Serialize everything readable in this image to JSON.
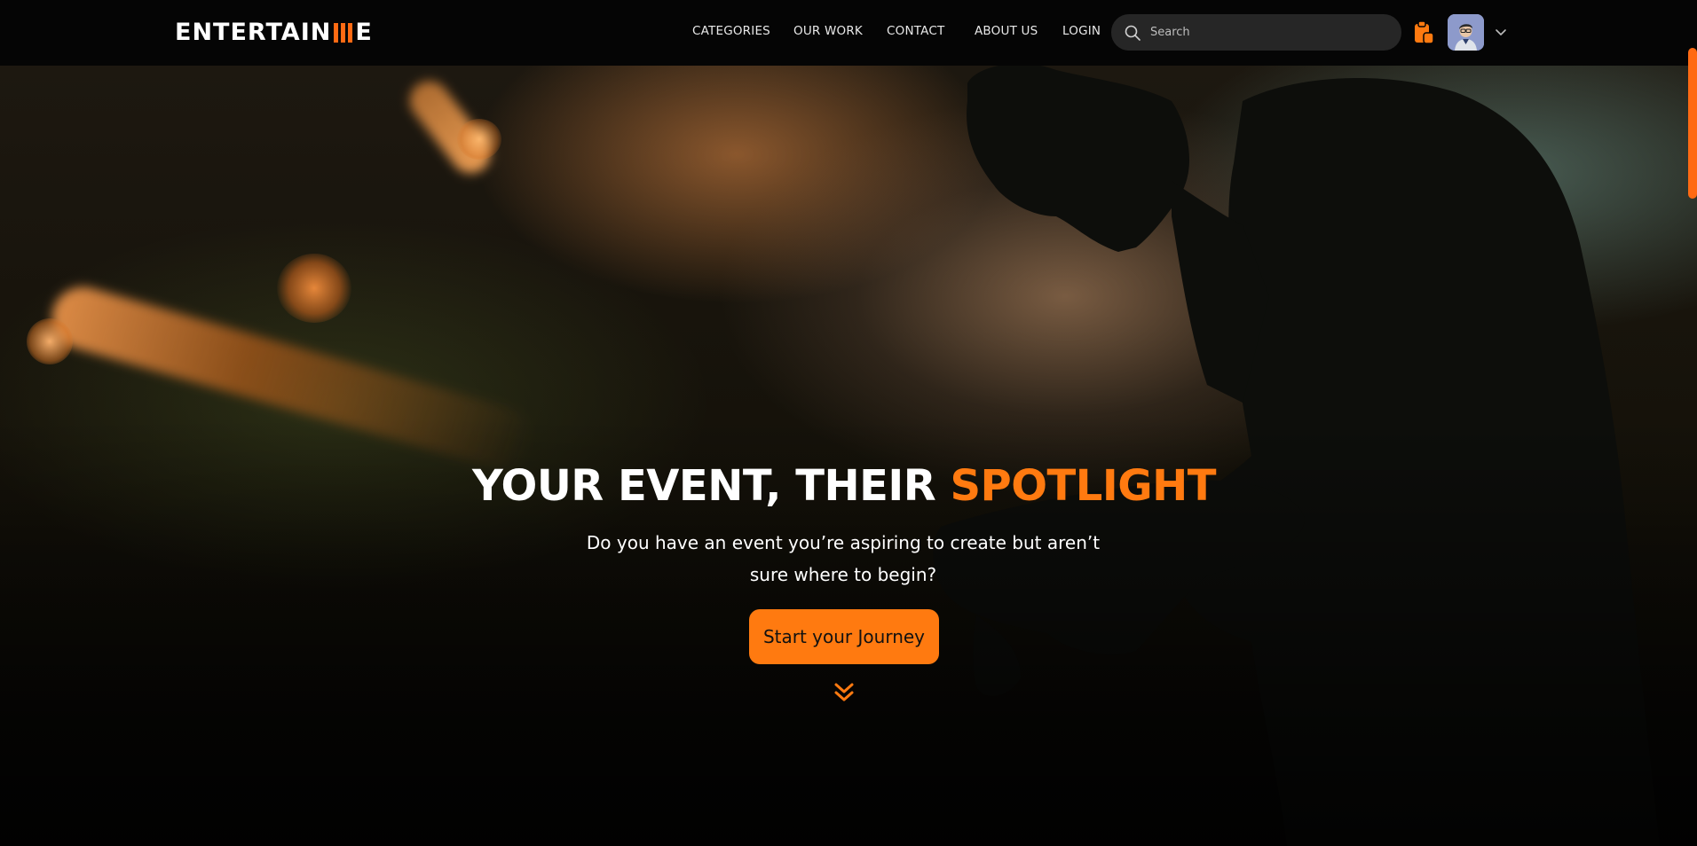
{
  "brand": {
    "logo_text_left": "ENTERTAIN",
    "logo_text_right": "E",
    "accent_color": "#ff7a10"
  },
  "nav": {
    "items": [
      {
        "label": "CATEGORIES"
      },
      {
        "label": "OUR WORK"
      },
      {
        "label": "CONTACT"
      },
      {
        "label": "ABOUT US"
      },
      {
        "label": "LOGIN"
      }
    ]
  },
  "search": {
    "placeholder": "Search",
    "value": ""
  },
  "header_icons": {
    "clipboard": "clipboard-icon",
    "avatar": "user-avatar",
    "menu": "chevron-down-icon"
  },
  "hero": {
    "headline_main": "YOUR EVENT, THEIR ",
    "headline_accent": "SPOTLIGHT",
    "subtext": "Do you have an event you’re aspiring to create but aren’t sure where to begin?",
    "cta_label": "Start your Journey",
    "scroll_icon": "double-chevron-down-icon"
  }
}
